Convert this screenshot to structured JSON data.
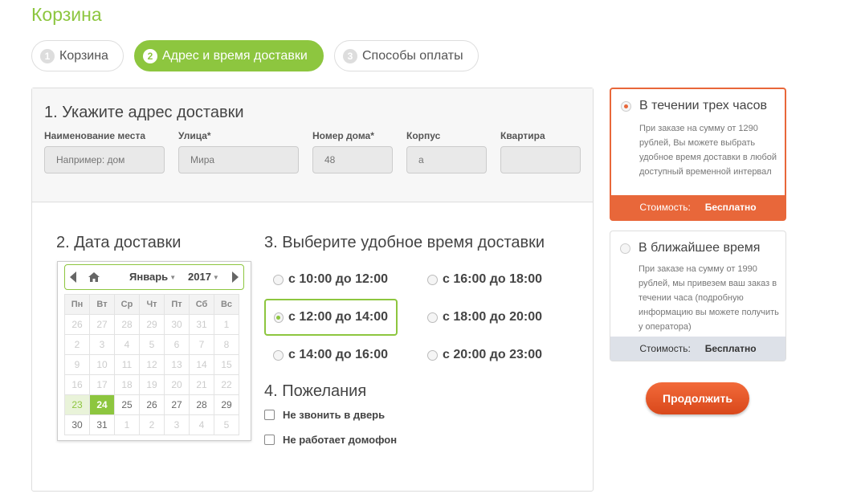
{
  "page": {
    "title": "Корзина"
  },
  "steps": [
    {
      "num": "1",
      "label": "Корзина"
    },
    {
      "num": "2",
      "label": "Адрес и время доставки"
    },
    {
      "num": "3",
      "label": "Способы оплаты"
    }
  ],
  "address": {
    "title": "1. Укажите адрес доставки",
    "fields": [
      {
        "label": "Наименование места",
        "placeholder": "Например: дом",
        "value": ""
      },
      {
        "label": "Улица*",
        "placeholder": "Мира",
        "value": ""
      },
      {
        "label": "Номер дома*",
        "placeholder": "48",
        "value": ""
      },
      {
        "label": "Корпус",
        "placeholder": "а",
        "value": ""
      },
      {
        "label": "Квартира",
        "placeholder": "",
        "value": ""
      }
    ]
  },
  "date": {
    "title": "2. Дата доставки",
    "month": "Январь",
    "year": "2017",
    "weekdays": [
      "Пн",
      "Вт",
      "Ср",
      "Чт",
      "Пт",
      "Сб",
      "Вс"
    ],
    "rows": [
      [
        "26",
        "27",
        "28",
        "29",
        "30",
        "31",
        "1"
      ],
      [
        "2",
        "3",
        "4",
        "5",
        "6",
        "7",
        "8"
      ],
      [
        "9",
        "10",
        "11",
        "12",
        "13",
        "14",
        "15"
      ],
      [
        "16",
        "17",
        "18",
        "19",
        "20",
        "21",
        "22"
      ],
      [
        "23",
        "24",
        "25",
        "26",
        "27",
        "28",
        "29"
      ],
      [
        "30",
        "31",
        "1",
        "2",
        "3",
        "4",
        "5"
      ]
    ],
    "selected_day": "24"
  },
  "time": {
    "title": "3. Выберите удобное время доставки",
    "options": [
      {
        "label": "с 10:00 до 12:00",
        "selected": false
      },
      {
        "label": "с 12:00 до 14:00",
        "selected": true
      },
      {
        "label": "с 14:00 до 16:00",
        "selected": false
      },
      {
        "label": "с 16:00 до 18:00",
        "selected": false
      },
      {
        "label": "с 18:00 до 20:00",
        "selected": false
      },
      {
        "label": "с 20:00 до 23:00",
        "selected": false
      }
    ]
  },
  "wishes": {
    "title": "4. Пожелания",
    "options": [
      {
        "label": "Не звонить в дверь",
        "checked": false
      },
      {
        "label": "Не работает домофон",
        "checked": false
      }
    ]
  },
  "delivery_options": [
    {
      "title": "В течении трех часов",
      "selected": true,
      "description": "При заказе на сумму от 1290 рублей, Вы можете выбрать удобное время доставки в любой доступный временной интервал",
      "cost_label": "Стоимость:",
      "cost_value": "Бесплатно"
    },
    {
      "title": "В ближайшее время",
      "selected": false,
      "description": "При заказе на сумму от 1990 рублей, мы привезем ваш заказ в течении часа (подробную информацию вы можете получить у оператора)",
      "cost_label": "Стоимость:",
      "cost_value": "Бесплатно"
    }
  ],
  "actions": {
    "continue_label": "Продолжить"
  },
  "colors": {
    "accent_green": "#8dc63f",
    "accent_orange": "#e8673a"
  }
}
